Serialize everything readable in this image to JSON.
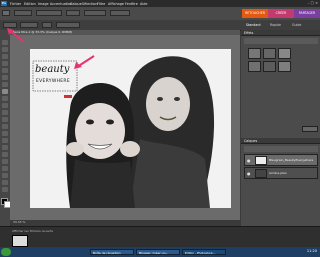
{
  "menubar": {
    "items": [
      "Fichier",
      "Edition",
      "Image",
      "Accentuation",
      "Calque",
      "Sélection",
      "Filtre",
      "Affichage",
      "Fenêtre",
      "Aide"
    ],
    "window_controls": "– □ ×"
  },
  "optionsbar": {
    "mode_tabs": [
      {
        "label": "RETOUCHER",
        "color": "#e25a0f"
      },
      {
        "label": "CRÉER",
        "color": "#c23a6e"
      },
      {
        "label": "PARTAGER",
        "color": "#7a3fa0"
      }
    ],
    "sub_tabs": [
      "Standard",
      "Rapide",
      "Guide"
    ]
  },
  "document": {
    "tab_title": "Sans titre-1 @ 33,3% (Calque 0, RVB/8)",
    "zoom": "33,33 %",
    "photo_text_line1": "beauty",
    "photo_text_line2": "EVERYWHERE"
  },
  "panels": {
    "effects_title": "Effets",
    "layers_title": "Calques",
    "layers": [
      {
        "name": "Bleugrain_BeautyEverywhere"
      },
      {
        "name": "Arrière-plan"
      }
    ]
  },
  "bin": {
    "label": "Afficher les fichiers ouverts"
  },
  "taskbar": {
    "items": [
      "Boîte de réception",
      "Blogger: Créer un...",
      "Editor - Photoshop..."
    ],
    "clock": "11:20"
  },
  "colors": {
    "accent_orange": "#e25a0f",
    "arrow_pink": "#e6336f"
  }
}
